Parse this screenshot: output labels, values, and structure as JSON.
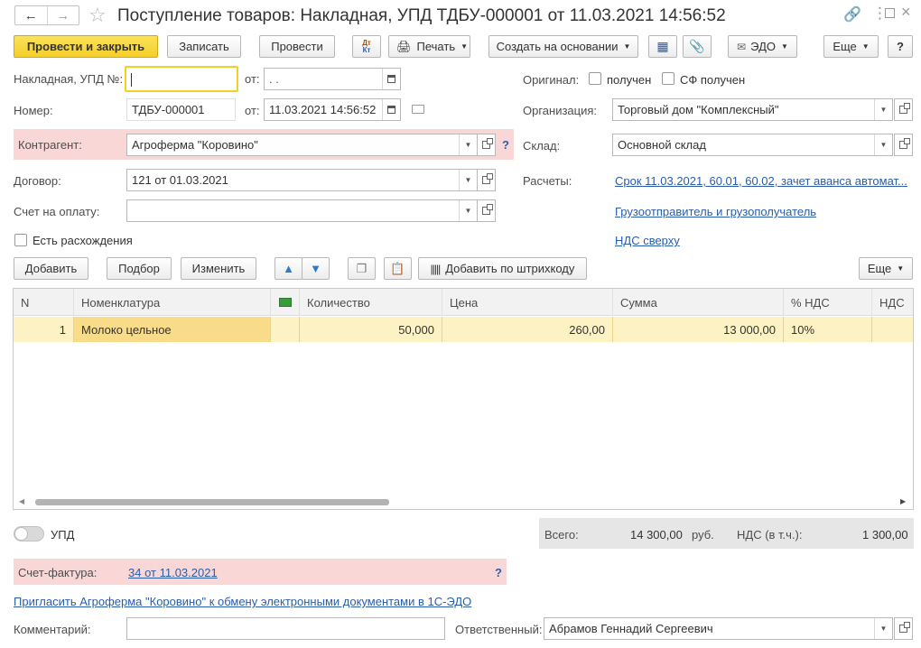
{
  "window": {
    "title": "Поступление товаров: Накладная, УПД ТДБУ-000001 от 11.03.2021 14:56:52",
    "nav_back_icon": "arrow-left-icon",
    "nav_forward_icon": "arrow-right-icon",
    "favorite_icon": "star-icon"
  },
  "toolbar": {
    "post_close": "Провести и закрыть",
    "save": "Записать",
    "post": "Провести",
    "dt_kt": "Дт Кт",
    "print": "Печать",
    "create_based": "Создать на основании",
    "edo": "ЭДО",
    "more": "Еще",
    "help": "?"
  },
  "form": {
    "invoice_label": "Накладная, УПД №:",
    "invoice_value": "",
    "from_label": "от:",
    "invoice_date_placeholder": " .  .",
    "number_label": "Номер:",
    "number_value": "ТДБУ-000001",
    "date_value": "11.03.2021 14:56:52",
    "counterparty_label": "Контрагент:",
    "counterparty_value": "Агроферма \"Коровино\"",
    "counterparty_help": "?",
    "contract_label": "Договор:",
    "contract_value": "121 от 01.03.2021",
    "payment_invoice_label": "Счет на оплату:",
    "payment_invoice_value": "",
    "discrepancies_label": "Есть расхождения",
    "original_label": "Оригинал:",
    "received_label": "получен",
    "sf_received_label": "СФ получен",
    "organization_label": "Организация:",
    "organization_value": "Торговый дом \"Комплексный\"",
    "warehouse_label": "Склад:",
    "warehouse_value": "Основной склад",
    "settlements_label": "Расчеты:",
    "settlements_link": "Срок 11.03.2021, 60.01, 60.02, зачет аванса автомат...",
    "shipper_link": "Грузоотправитель и грузополучатель",
    "vat_link": "НДС сверху"
  },
  "table_toolbar": {
    "add": "Добавить",
    "pick": "Подбор",
    "edit": "Изменить",
    "add_barcode": "Добавить по штрихкоду",
    "more": "Еще"
  },
  "table": {
    "columns": [
      "N",
      "Номенклатура",
      "Количество",
      "Цена",
      "Сумма",
      "% НДС",
      "НДС"
    ],
    "rows": [
      {
        "n": "1",
        "item": "Молоко цельное",
        "qty": "50,000",
        "price": "260,00",
        "sum": "13 000,00",
        "vat_rate": "10%",
        "vat": ""
      }
    ]
  },
  "footer": {
    "upd_label": "УПД",
    "total_label": "Всего:",
    "total_value": "14 300,00",
    "currency": "руб.",
    "vat_total_label": "НДС (в т.ч.):",
    "vat_total_value": "1 300,00",
    "invoice_label": "Счет-фактура:",
    "invoice_link": "34 от 11.03.2021",
    "invoice_help": "?",
    "invite_link": "Пригласить Агроферма \"Коровино\" к обмену электронными документами в 1С-ЭДО",
    "comment_label": "Комментарий:",
    "comment_value": "",
    "responsible_label": "Ответственный:",
    "responsible_value": "Абрамов Геннадий Сергеевич"
  },
  "colors": {
    "accent_yellow": "#f5cf29",
    "pink_band": "#fad7d7",
    "row_selected": "#fdf2c4",
    "link": "#2a5da8"
  }
}
